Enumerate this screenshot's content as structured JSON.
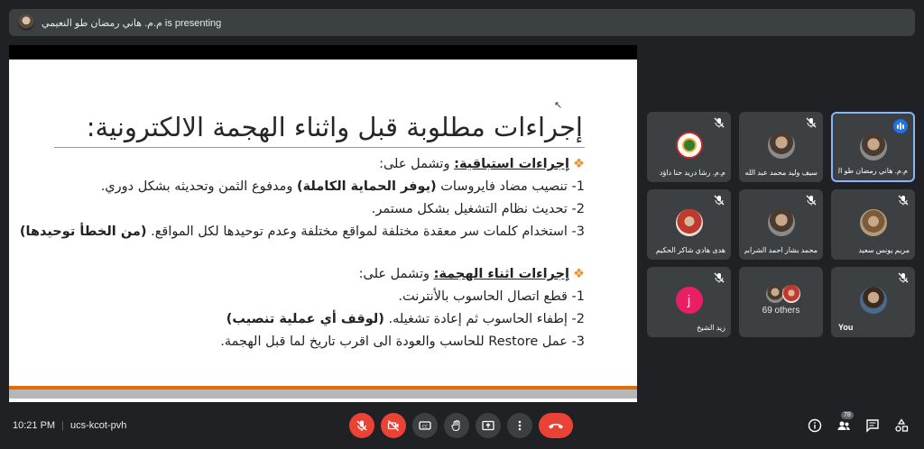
{
  "presenter": {
    "label": "م.م. هاني رمضان طو النعيمي is presenting"
  },
  "slide": {
    "title": "إجراءات مطلوبة قبل واثناء الهجمة الالكترونية:",
    "section1": {
      "heading": "إجراءات استباقية:",
      "intro": "وتشمل على:"
    },
    "s1_items": [
      {
        "text": "1- تنصيب مضاد فايروسات ",
        "bold": "(يوفر الحماية الكاملة)",
        "rest": " ومدفوع الثمن وتحديثه بشكل دوري."
      },
      {
        "text": "2- تحديث نظام التشغيل بشكل مستمر."
      },
      {
        "text": "3- استخدام كلمات سر معقدة  مختلفة لمواقع مختلفة وعدم توحيدها لكل المواقع. ",
        "bold": "(من الخطأ توحيدها)"
      }
    ],
    "section2": {
      "heading": "إجراءات اثناء الهجمة:",
      "intro": "وتشمل على:"
    },
    "s2_items": [
      {
        "text": "1- قطع اتصال الحاسوب بالأنترنت."
      },
      {
        "text": "2- إطفاء الحاسوب ثم إعادة تشغيله. ",
        "bold": "(لوقف أي عملية تنصيب)"
      },
      {
        "text": "3- عمل Restore للحاسب والعودة الى اقرب تاريخ لما قبل الهجمة."
      }
    ]
  },
  "participants": [
    {
      "name": "م.م. رشا دريد حنا داؤد"
    },
    {
      "name": "سيف وليد محمد عبد الله"
    },
    {
      "name": "م.م. هاني رمضان طو النعيمي"
    },
    {
      "name": "هدى هادي شاكر الحكيم"
    },
    {
      "name": "محمد بشار احمد الشرابي"
    },
    {
      "name": "مريم يونس سعيد"
    },
    {
      "name": "زيد الشيخ",
      "initial": "j"
    },
    {
      "name": "69 others"
    },
    {
      "name": "You"
    }
  ],
  "meeting": {
    "time": "10:21 PM",
    "code": "ucs-kcot-pvh",
    "people_count": "78"
  },
  "colors": {
    "accent": "#8ab4f8",
    "danger": "#ea4335",
    "slide_orange": "#e36c09",
    "bullet": "#e69138"
  }
}
